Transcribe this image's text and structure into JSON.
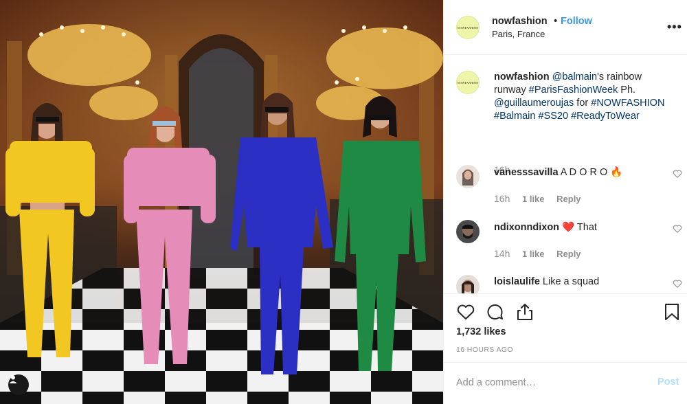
{
  "post": {
    "username": "nowfashion",
    "separator": "•",
    "follow_label": "Follow",
    "location": "Paris, France",
    "more_label": "•••",
    "avatar_text": "NOWFASHION"
  },
  "caption": {
    "username": "nowfashion",
    "parts": [
      {
        "text": " ",
        "link": false
      },
      {
        "text": "@balmain",
        "link": true
      },
      {
        "text": "'s rainbow runway ",
        "link": false
      },
      {
        "text": "#ParisFashionWeek",
        "link": true
      },
      {
        "text": " Ph. ",
        "link": false
      },
      {
        "text": "@guillaumeroujas",
        "link": true
      },
      {
        "text": " for ",
        "link": false
      },
      {
        "text": "#NOWFASHION",
        "link": true
      },
      {
        "text": " ",
        "link": false
      },
      {
        "text": "#Balmain",
        "link": true
      },
      {
        "text": " ",
        "link": false
      },
      {
        "text": "#SS20",
        "link": true
      },
      {
        "text": " ",
        "link": false
      },
      {
        "text": "#ReadyToWear",
        "link": true
      }
    ],
    "time": "16h"
  },
  "comments": [
    {
      "username": "vanesssavilla",
      "text": "A D O R O 🔥",
      "time": "16h",
      "likes": "1 like",
      "reply": "Reply"
    },
    {
      "username": "ndixonndixon",
      "text": "❤️  That",
      "time": "14h",
      "likes": "1 like",
      "reply": "Reply"
    },
    {
      "username": "loislaulife",
      "text": "Like a squad",
      "time": "",
      "likes": "",
      "reply": ""
    }
  ],
  "actions": {
    "like_icon": "heart-icon",
    "comment_icon": "comment-icon",
    "share_icon": "share-icon",
    "save_icon": "bookmark-icon",
    "likes_count": "1,732 likes",
    "posted_ago": "16 HOURS AGO"
  },
  "add_comment": {
    "placeholder": "Add a comment…",
    "post_label": "Post"
  },
  "colors": {
    "link": "#003569",
    "follow": "#3897f0",
    "post_disabled": "#b2dffc",
    "muted": "#8e8e8e"
  }
}
